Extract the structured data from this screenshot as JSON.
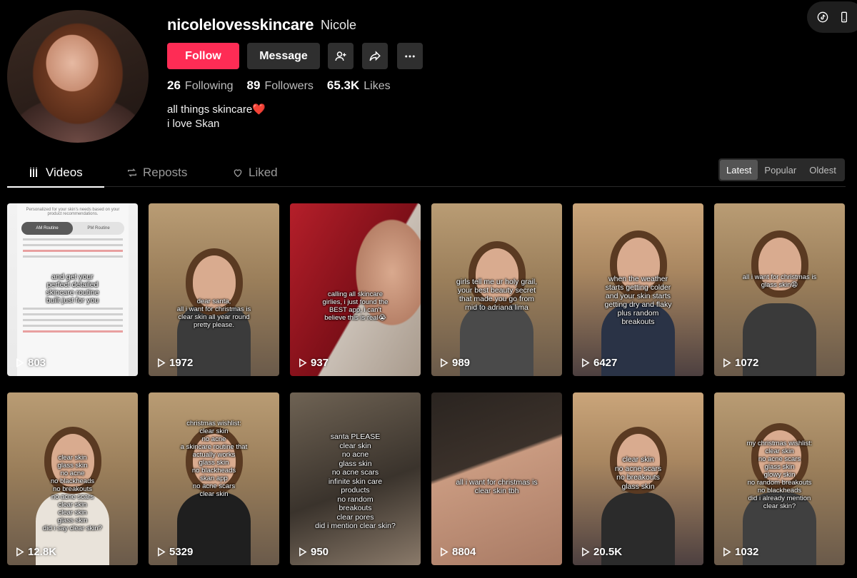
{
  "profile": {
    "username": "nicolelovesskincare",
    "nickname": "Nicole",
    "follow_label": "Follow",
    "message_label": "Message",
    "stats": {
      "following_count": "26",
      "following_label": "Following",
      "followers_count": "89",
      "followers_label": "Followers",
      "likes_count": "65.3K",
      "likes_label": "Likes"
    },
    "bio_line1": "all things skincare❤️",
    "bio_line2": "i love Skan"
  },
  "tabs": [
    {
      "label": "Videos",
      "icon": "grid-icon",
      "active": true
    },
    {
      "label": "Reposts",
      "icon": "repost-icon",
      "active": false
    },
    {
      "label": "Liked",
      "icon": "liked-heart-icon",
      "active": false
    }
  ],
  "sort": {
    "options": [
      "Latest",
      "Popular",
      "Oldest"
    ],
    "selected": "Latest"
  },
  "colors": {
    "accent": "#fe2c55",
    "background": "#000000",
    "button": "#2f2f2f"
  },
  "videos": [
    {
      "views": "803",
      "caption": "and get your\nperfect detailed\nskincare routine\nbuilt just for you",
      "screen": {
        "header": "Personalized for your skin's needs based on your product recommendations.",
        "tab_am": "AM Routine",
        "tab_pm": "PM Routine"
      }
    },
    {
      "views": "1972",
      "caption": "dear santa,\nall i want for christmas is\nclear skin all year round\npretty please."
    },
    {
      "views": "937",
      "caption": "calling all skincare\ngirlies, i just found the\nBEST app, i can't\nbelieve this is real😭"
    },
    {
      "views": "989",
      "caption": "girls tell me ur holy grail,\nyour best beauty secret\nthat made you go from\nmid to adriana lima"
    },
    {
      "views": "6427",
      "caption": "when the weather\nstarts getting colder\nand your skin starts\ngetting dry and flaky\nplus random\nbreakouts"
    },
    {
      "views": "1072",
      "caption": "all i want for christmas is\nglass skin😩"
    },
    {
      "views": "12.8K",
      "caption": "clear skin\nglass skin\nno acne\nno blackheads\nno breakouts\nno acne scars\nclear skin\nclear skin\nglass skin\ndid i say clear skin?"
    },
    {
      "views": "5329",
      "caption": "christmas wishlist:\nclear skin\nno acne\na skincare routine that\nactually works\nglass skin\nno blackheads\nskan app\nno acne scars\nclear skin"
    },
    {
      "views": "950",
      "caption": "santa PLEASE\nclear skin\nno acne\nglass skin\nno acne scars\ninfinite skin care\nproducts\nno random\nbreakouts\nclear pores\ndid i mention clear skin?"
    },
    {
      "views": "8804",
      "caption": "all i want for christmas is\nclear skin tbh"
    },
    {
      "views": "20.5K",
      "caption": "clear skin\nno acne scars\nno breakouts\nglass skin"
    },
    {
      "views": "1032",
      "caption": "my christmas wishlist:\nclear skin\nno acne scars\nglass skin\nglowy skin\nno random breakouts\nno blackheads\ndid i already mention\nclear skin?"
    }
  ]
}
